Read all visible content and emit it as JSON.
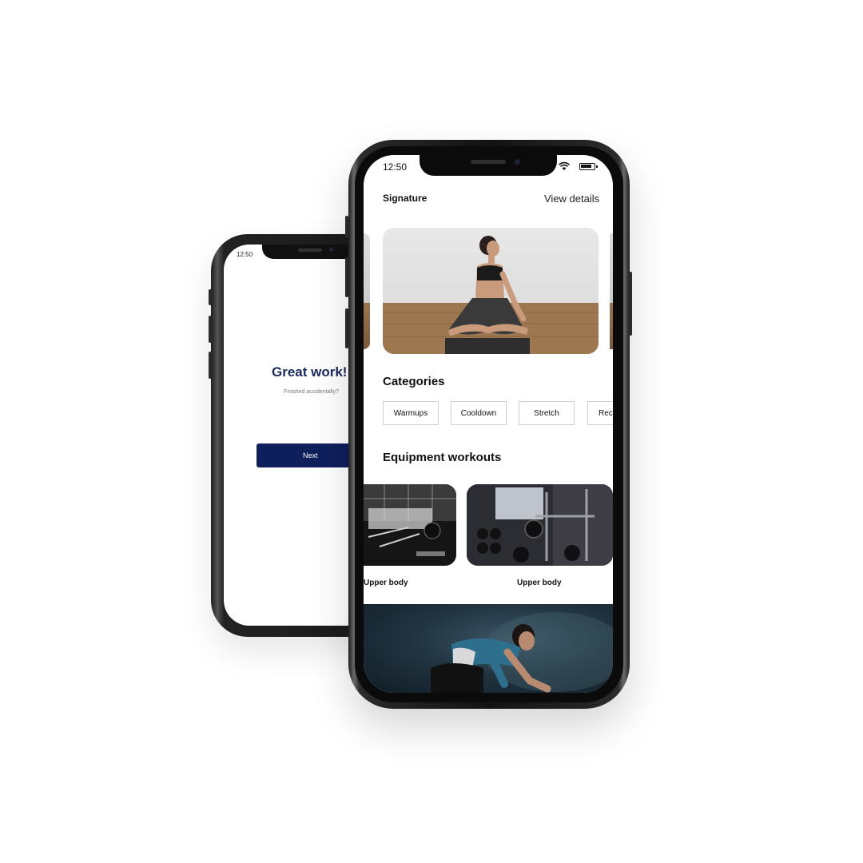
{
  "back_phone": {
    "status_time": "12:50",
    "title": "Great work!",
    "subtitle": "Finished accidentally?",
    "next_label": "Next"
  },
  "front_phone": {
    "status_time": "12:50",
    "signature": {
      "title": "Signature",
      "view_details": "View details"
    },
    "categories": {
      "title": "Categories",
      "items": [
        "Warmups",
        "Cooldown",
        "Stretch",
        "Rec"
      ]
    },
    "equipment": {
      "title": "Equipment workouts",
      "cards": [
        {
          "label": "Upper body"
        },
        {
          "label": "Upper body"
        }
      ]
    }
  },
  "colors": {
    "primary_navy": "#0f1f5c",
    "title_navy": "#1b2a5e",
    "background": "#ffffff"
  }
}
